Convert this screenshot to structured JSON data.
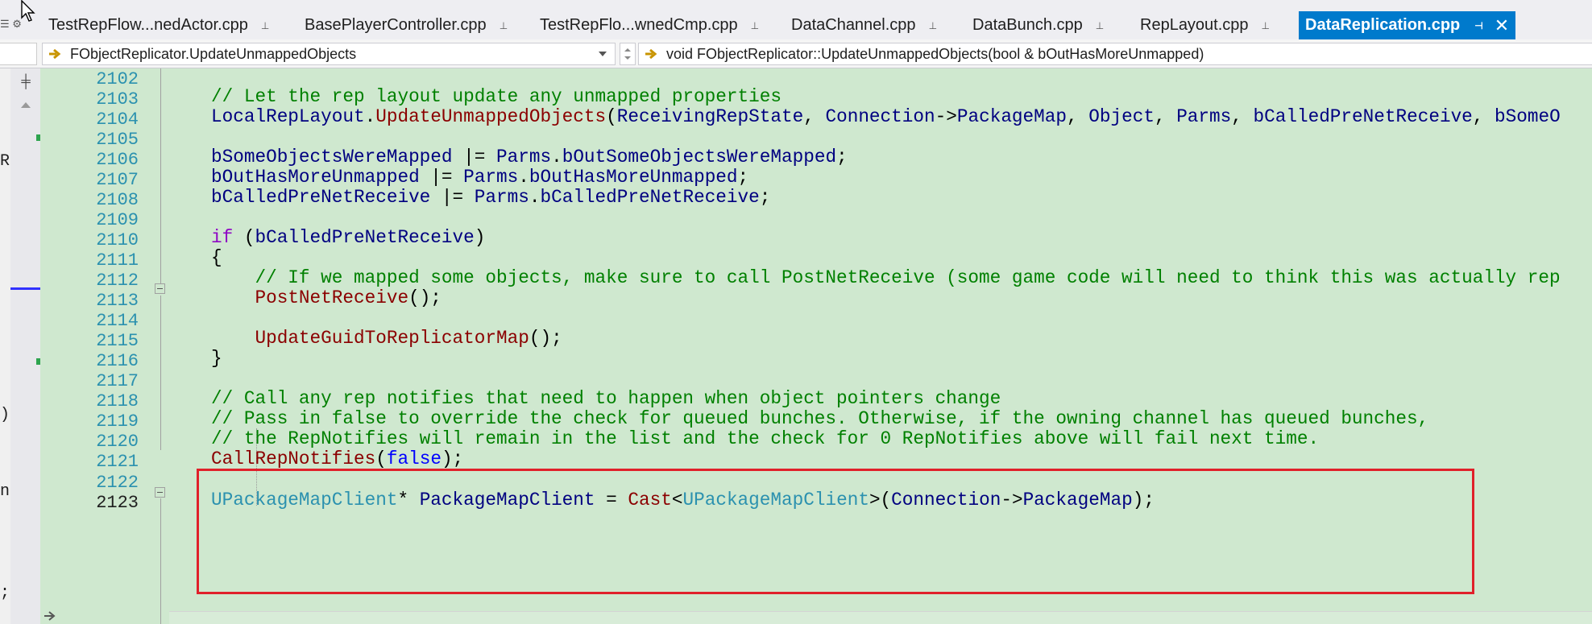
{
  "tabs": [
    {
      "label": "TestRepFlow...nedActor.cpp",
      "pin": "⊥"
    },
    {
      "label": "BasePlayerController.cpp",
      "pin": "⊥"
    },
    {
      "label": "TestRepFlo...wnedCmp.cpp",
      "pin": "⊥"
    },
    {
      "label": "DataChannel.cpp",
      "pin": "⊥"
    },
    {
      "label": "DataBunch.cpp",
      "pin": "⊥"
    },
    {
      "label": "RepLayout.cpp",
      "pin": "⊥"
    },
    {
      "label": "DataReplication.cpp",
      "pin": "⊣",
      "close": "✕",
      "active": true
    }
  ],
  "nav": {
    "scope": "FObjectReplicator.UpdateUnmappedObjects",
    "member": "void FObjectReplicator::UpdateUnmappedObjects(bool & bOutHasMoreUnmapped)"
  },
  "left_strip_glyphs": [
    "R",
    ")",
    "n",
    ";"
  ],
  "colors": {
    "editor_bg": "#cfe8cf",
    "active_tab": "#007acc",
    "highlight_border": "#e0202a",
    "line_number": "#2b91af",
    "comment": "#008000"
  },
  "lines": [
    {
      "n": "2102",
      "tokens": []
    },
    {
      "n": "2103",
      "tokens": [
        {
          "c": "cm",
          "t": "// Let the rep layout update any unmapped properties"
        }
      ]
    },
    {
      "n": "2104",
      "tokens": [
        {
          "c": "id",
          "t": "LocalRepLayout"
        },
        {
          "c": "pl",
          "t": "."
        },
        {
          "c": "fn",
          "t": "UpdateUnmappedObjects"
        },
        {
          "c": "pl",
          "t": "("
        },
        {
          "c": "id",
          "t": "ReceivingRepState"
        },
        {
          "c": "pl",
          "t": ", "
        },
        {
          "c": "id",
          "t": "Connection"
        },
        {
          "c": "pl",
          "t": "->"
        },
        {
          "c": "id",
          "t": "PackageMap"
        },
        {
          "c": "pl",
          "t": ", "
        },
        {
          "c": "id",
          "t": "Object"
        },
        {
          "c": "pl",
          "t": ", "
        },
        {
          "c": "id",
          "t": "Parms"
        },
        {
          "c": "pl",
          "t": ", "
        },
        {
          "c": "id",
          "t": "bCalledPreNetReceive"
        },
        {
          "c": "pl",
          "t": ", "
        },
        {
          "c": "id",
          "t": "bSomeO"
        }
      ]
    },
    {
      "n": "2105",
      "tokens": []
    },
    {
      "n": "2106",
      "tokens": [
        {
          "c": "id",
          "t": "bSomeObjectsWereMapped"
        },
        {
          "c": "pl",
          "t": " |= "
        },
        {
          "c": "id",
          "t": "Parms"
        },
        {
          "c": "pl",
          "t": "."
        },
        {
          "c": "id",
          "t": "bOutSomeObjectsWereMapped"
        },
        {
          "c": "pl",
          "t": ";"
        }
      ]
    },
    {
      "n": "2107",
      "tokens": [
        {
          "c": "id",
          "t": "bOutHasMoreUnmapped"
        },
        {
          "c": "pl",
          "t": " |= "
        },
        {
          "c": "id",
          "t": "Parms"
        },
        {
          "c": "pl",
          "t": "."
        },
        {
          "c": "id",
          "t": "bOutHasMoreUnmapped"
        },
        {
          "c": "pl",
          "t": ";"
        }
      ]
    },
    {
      "n": "2108",
      "tokens": [
        {
          "c": "id",
          "t": "bCalledPreNetReceive"
        },
        {
          "c": "pl",
          "t": " |= "
        },
        {
          "c": "id",
          "t": "Parms"
        },
        {
          "c": "pl",
          "t": "."
        },
        {
          "c": "id",
          "t": "bCalledPreNetReceive"
        },
        {
          "c": "pl",
          "t": ";"
        }
      ]
    },
    {
      "n": "2109",
      "tokens": []
    },
    {
      "n": "2110",
      "tokens": [
        {
          "c": "kw",
          "t": "if"
        },
        {
          "c": "pl",
          "t": " ("
        },
        {
          "c": "id",
          "t": "bCalledPreNetReceive"
        },
        {
          "c": "pl",
          "t": ")"
        }
      ]
    },
    {
      "n": "2111",
      "tokens": [
        {
          "c": "pl",
          "t": "{"
        }
      ]
    },
    {
      "n": "2112",
      "tokens": [
        {
          "c": "cm",
          "t": "    // If we mapped some objects, make sure to call PostNetReceive (some game code will need to think this was actually rep"
        }
      ]
    },
    {
      "n": "2113",
      "tokens": [
        {
          "c": "pl",
          "t": "    "
        },
        {
          "c": "fn",
          "t": "PostNetReceive"
        },
        {
          "c": "pl",
          "t": "();"
        }
      ]
    },
    {
      "n": "2114",
      "tokens": []
    },
    {
      "n": "2115",
      "tokens": [
        {
          "c": "pl",
          "t": "    "
        },
        {
          "c": "fn",
          "t": "UpdateGuidToReplicatorMap"
        },
        {
          "c": "pl",
          "t": "();"
        }
      ]
    },
    {
      "n": "2116",
      "tokens": [
        {
          "c": "pl",
          "t": "}"
        }
      ]
    },
    {
      "n": "2117",
      "tokens": []
    },
    {
      "n": "2118",
      "tokens": [
        {
          "c": "cm",
          "t": "// Call any rep notifies that need to happen when object pointers change"
        }
      ]
    },
    {
      "n": "2119",
      "tokens": [
        {
          "c": "cm",
          "t": "// Pass in false to override the check for queued bunches. Otherwise, if the owning channel has queued bunches,"
        }
      ]
    },
    {
      "n": "2120",
      "tokens": [
        {
          "c": "cm",
          "t": "// the RepNotifies will remain in the list and the check for 0 RepNotifies above will fail next time."
        }
      ]
    },
    {
      "n": "2121",
      "tokens": [
        {
          "c": "fn",
          "t": "CallRepNotifies"
        },
        {
          "c": "pl",
          "t": "("
        },
        {
          "c": "kw2",
          "t": "false"
        },
        {
          "c": "pl",
          "t": ");"
        }
      ]
    },
    {
      "n": "2122",
      "tokens": []
    },
    {
      "n": "2123",
      "tokens": [
        {
          "c": "ty",
          "t": "UPackageMapClient"
        },
        {
          "c": "pl",
          "t": "* "
        },
        {
          "c": "id",
          "t": "PackageMapClient"
        },
        {
          "c": "pl",
          "t": " = "
        },
        {
          "c": "fn",
          "t": "Cast"
        },
        {
          "c": "pl",
          "t": "<"
        },
        {
          "c": "ty",
          "t": "UPackageMapClient"
        },
        {
          "c": "pl",
          "t": ">("
        },
        {
          "c": "id",
          "t": "Connection"
        },
        {
          "c": "pl",
          "t": "->"
        },
        {
          "c": "id",
          "t": "PackageMap"
        },
        {
          "c": "pl",
          "t": ");"
        }
      ],
      "current": true
    }
  ]
}
